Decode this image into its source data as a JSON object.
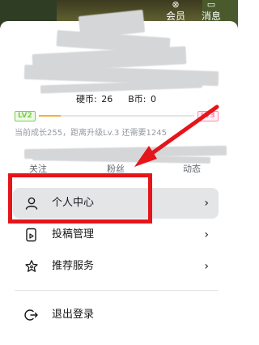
{
  "header": {
    "member_label": "会员",
    "message_label": "消息"
  },
  "profile": {
    "coins": [
      {
        "label": "硬币:",
        "value": "26"
      },
      {
        "label": "B币:",
        "value": "0"
      }
    ]
  },
  "level": {
    "current_badge": "LV2",
    "next_badge": "LV3",
    "progress": 0.14,
    "text": "当前成长255，距离升级Lv.3 还需要1245"
  },
  "stats": {
    "items": [
      {
        "label": "关注"
      },
      {
        "label": "粉丝"
      },
      {
        "label": "动态"
      }
    ]
  },
  "menu": {
    "items": [
      {
        "label": "个人中心",
        "icon": "user-icon",
        "arrow": "›",
        "active": true
      },
      {
        "label": "投稿管理",
        "icon": "upload-manage-icon",
        "arrow": "›",
        "active": false
      },
      {
        "label": "推荐服务",
        "icon": "star-icon",
        "arrow": "›",
        "active": false
      }
    ],
    "logout": {
      "label": "退出登录",
      "icon": "logout-icon"
    }
  },
  "colors": {
    "annotation_red": "#e5151a",
    "active_bg": "#e3e5e7",
    "level_green": "#7bd049",
    "level_pink": "#ff8cb0",
    "progress_orange": "#f4b03e"
  }
}
